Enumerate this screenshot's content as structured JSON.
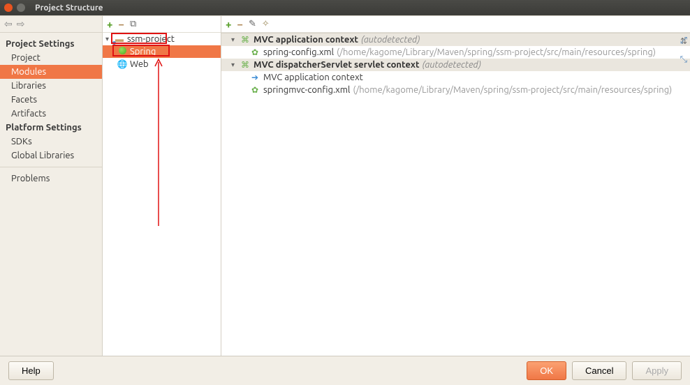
{
  "window": {
    "title": "Project Structure"
  },
  "sidebar": {
    "sections": [
      {
        "header": "Project Settings",
        "items": [
          "Project",
          "Modules",
          "Libraries",
          "Facets",
          "Artifacts"
        ]
      },
      {
        "header": "Platform Settings",
        "items": [
          "SDKs",
          "Global Libraries"
        ]
      },
      {
        "header": null,
        "items": [
          "Problems"
        ]
      }
    ],
    "selected": "Modules"
  },
  "module_tree": {
    "root": "ssm-project",
    "children": [
      {
        "label": "Spring",
        "icon": "spring"
      },
      {
        "label": "Web",
        "icon": "web"
      }
    ],
    "selected": "Spring"
  },
  "details": {
    "contexts": [
      {
        "name": "MVC application context",
        "autodetected": "(autodetected)",
        "items": [
          {
            "type": "config",
            "file": "spring-config.xml",
            "path": "(/home/kagome/Library/Maven/spring/ssm-project/src/main/resources/spring)"
          }
        ]
      },
      {
        "name": "MVC dispatcherServlet servlet context",
        "autodetected": "(autodetected)",
        "items": [
          {
            "type": "link",
            "file": "MVC application context",
            "path": ""
          },
          {
            "type": "config",
            "file": "springmvc-config.xml",
            "path": "(/home/kagome/Library/Maven/spring/ssm-project/src/main/resources/spring)"
          }
        ]
      }
    ]
  },
  "footer": {
    "help": "Help",
    "ok": "OK",
    "cancel": "Cancel",
    "apply": "Apply"
  }
}
